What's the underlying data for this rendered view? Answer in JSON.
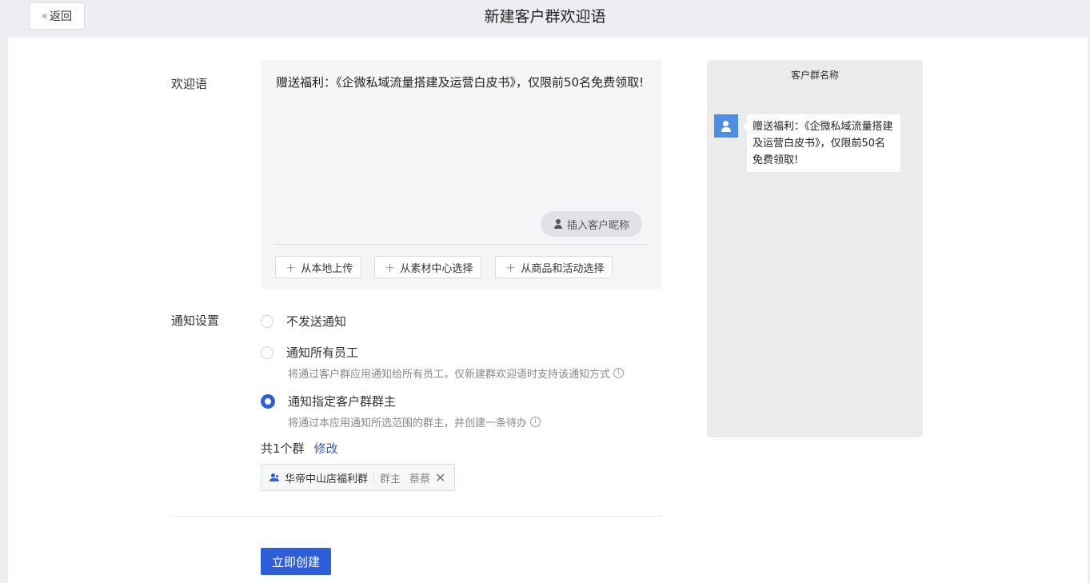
{
  "header": {
    "back_label": "返回",
    "title": "新建客户群欢迎语"
  },
  "form": {
    "welcome_label": "欢迎语",
    "welcome_text": "赠送福利：《企微私域流量搭建及运营白皮书》，仅限前50名免费领取!",
    "insert_nickname_label": "插入客户昵称",
    "upload_buttons": [
      "从本地上传",
      "从素材中心选择",
      "从商品和活动选择"
    ],
    "notify_label": "通知设置",
    "notify_options": [
      {
        "label": "不发送通知",
        "hint": "",
        "selected": false
      },
      {
        "label": "通知所有员工",
        "hint": "将通过客户群应用通知给所有员工，仅新建群欢迎语时支持该通知方式",
        "selected": false
      },
      {
        "label": "通知指定客户群群主",
        "hint": "将通过本应用通知所选范围的群主，并创建一条待办",
        "selected": true
      }
    ],
    "group_count_text": "共1个群",
    "modify_label": "修改",
    "group_chip": {
      "name": "华帝中山店福利群",
      "role": "群主",
      "owner": "蔡蔡"
    },
    "submit_label": "立即创建"
  },
  "preview": {
    "group_name": "客户群名称",
    "bubble_text": "赠送福利：《企微私域流量搭建及运营白皮书》，仅限前50名免费领取!"
  },
  "colors": {
    "primary": "#2f5fd8",
    "avatar": "#4c8ee6",
    "page_bg": "#eceef2"
  },
  "icons": {
    "back": "double-chevron-left-icon",
    "insert": "person-icon",
    "upload": "plus-icon",
    "info": "info-circle-icon",
    "group": "group-users-icon",
    "close": "close-icon"
  }
}
